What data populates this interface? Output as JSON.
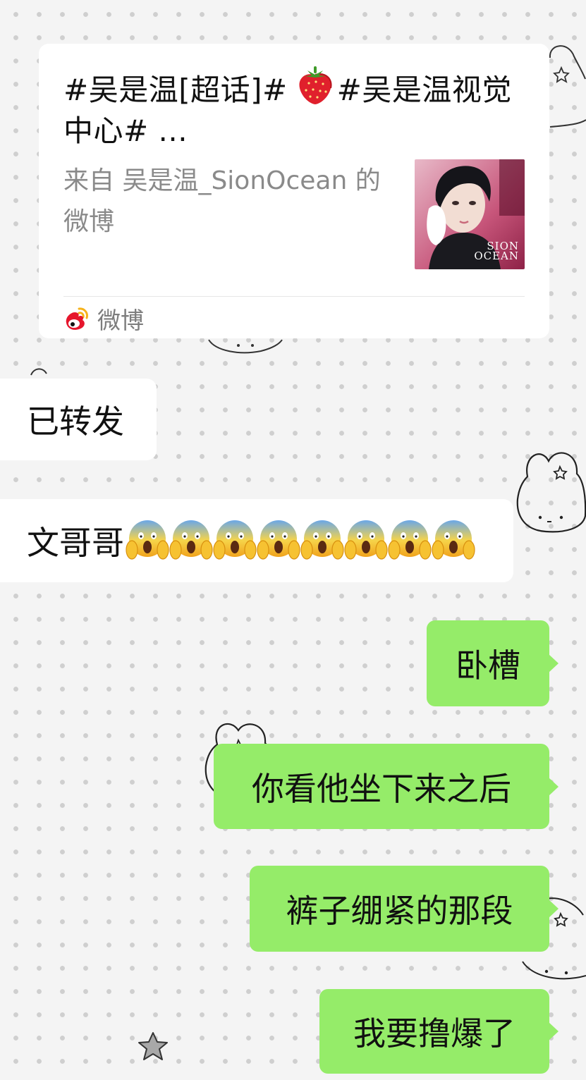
{
  "card": {
    "title_part1": "#吴是温[超话]#",
    "title_part2": "#吴是温视觉中心# ...",
    "source": "来自 吴是温_SionOcean 的微博",
    "thumbnail_icon": "portrait-photo",
    "thumbnail_brand_line1": "SION",
    "thumbnail_brand_line2": "OCEAN",
    "footer_icon": "weibo-logo-icon",
    "footer_label": "微博"
  },
  "messages": [
    {
      "side": "left",
      "text": "已转发"
    },
    {
      "side": "left",
      "text": "文哥哥",
      "emoji": "face-screaming-in-fear-icon",
      "emoji_count": 8
    },
    {
      "side": "right",
      "text": "卧槽"
    },
    {
      "side": "right",
      "text": "你看他坐下来之后"
    },
    {
      "side": "right",
      "text": "裤子绷紧的那段"
    },
    {
      "side": "right",
      "text": "我要撸爆了"
    }
  ],
  "colors": {
    "background": "#f4f4f4",
    "dot": "#cfcfcf",
    "incoming_bubble": "#ffffff",
    "outgoing_bubble": "#95ec69",
    "source_text": "#8a8a8a"
  },
  "decorations": [
    "bunny-doodle-icon",
    "star-doodle-icon"
  ]
}
